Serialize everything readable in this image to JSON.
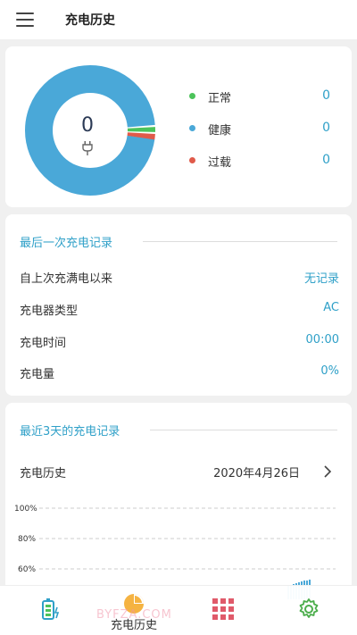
{
  "header": {
    "title": "充电历史"
  },
  "status_card": {
    "center_value": "0",
    "legend": [
      {
        "label": "正常",
        "value": "0",
        "color": "#4cc35a"
      },
      {
        "label": "健康",
        "value": "0",
        "color": "#4aa8d8"
      },
      {
        "label": "过载",
        "value": "0",
        "color": "#e05a4a"
      }
    ]
  },
  "last_charge": {
    "title": "最后一次充电记录",
    "rows": [
      {
        "label": "自上次充满电以来",
        "value": "无记录"
      },
      {
        "label": "充电器类型",
        "value": "AC"
      },
      {
        "label": "充电时间",
        "value": "00:00"
      },
      {
        "label": "充电量",
        "value": "0%"
      }
    ]
  },
  "recent": {
    "title": "最近3天的充电记录",
    "history_label": "充电历史",
    "date": "2020年4月26日"
  },
  "chart_data": {
    "type": "area",
    "y_tick_labels": [
      "100%",
      "80%",
      "60%"
    ],
    "grid": "dashed",
    "color": "#4aa8d8"
  },
  "bottom_nav": {
    "items": [
      {
        "icon": "battery-icon"
      },
      {
        "icon": "pie-chart-icon",
        "label": "充电历史"
      },
      {
        "icon": "grid-icon"
      },
      {
        "icon": "gear-icon"
      }
    ],
    "watermark": "BYFZA.COM"
  }
}
